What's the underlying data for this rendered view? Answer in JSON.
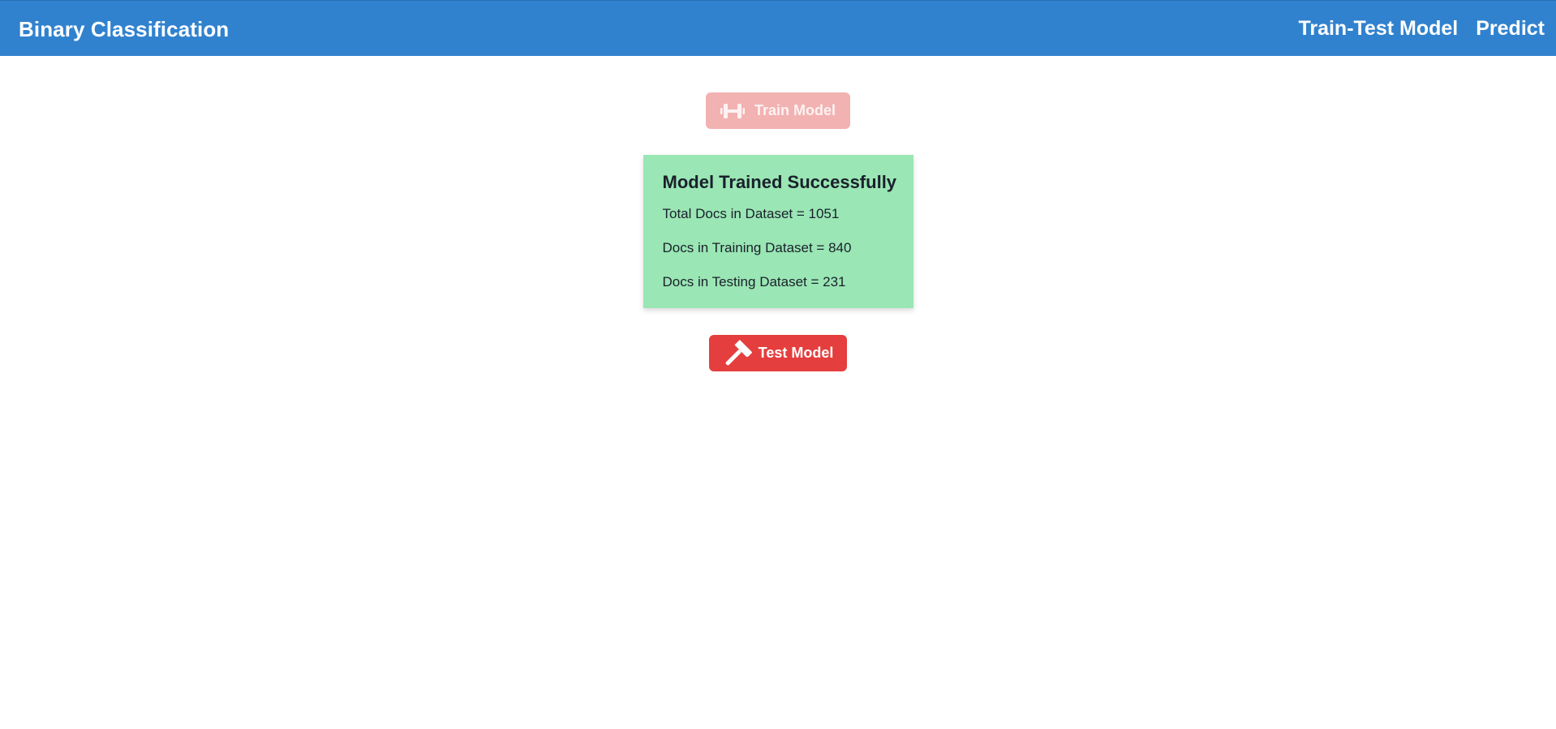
{
  "navbar": {
    "brand": "Binary Classification",
    "links": [
      {
        "label": "Train-Test Model"
      },
      {
        "label": "Predict"
      }
    ]
  },
  "train_button": {
    "label": "Train Model",
    "icon": "dumbbell-icon",
    "state": "disabled"
  },
  "result_card": {
    "title": "Model Trained Successfully",
    "lines": [
      "Total Docs in Dataset = 1051",
      "Docs in Training Dataset = 840",
      "Docs in Testing Dataset = 231"
    ]
  },
  "test_button": {
    "label": "Test Model",
    "icon": "hammer-icon"
  },
  "colors": {
    "navbar": "#3182ce",
    "train_button_disabled": "#f2b2b2",
    "test_button": "#e53e3e",
    "card_background": "#9ae6b4"
  }
}
